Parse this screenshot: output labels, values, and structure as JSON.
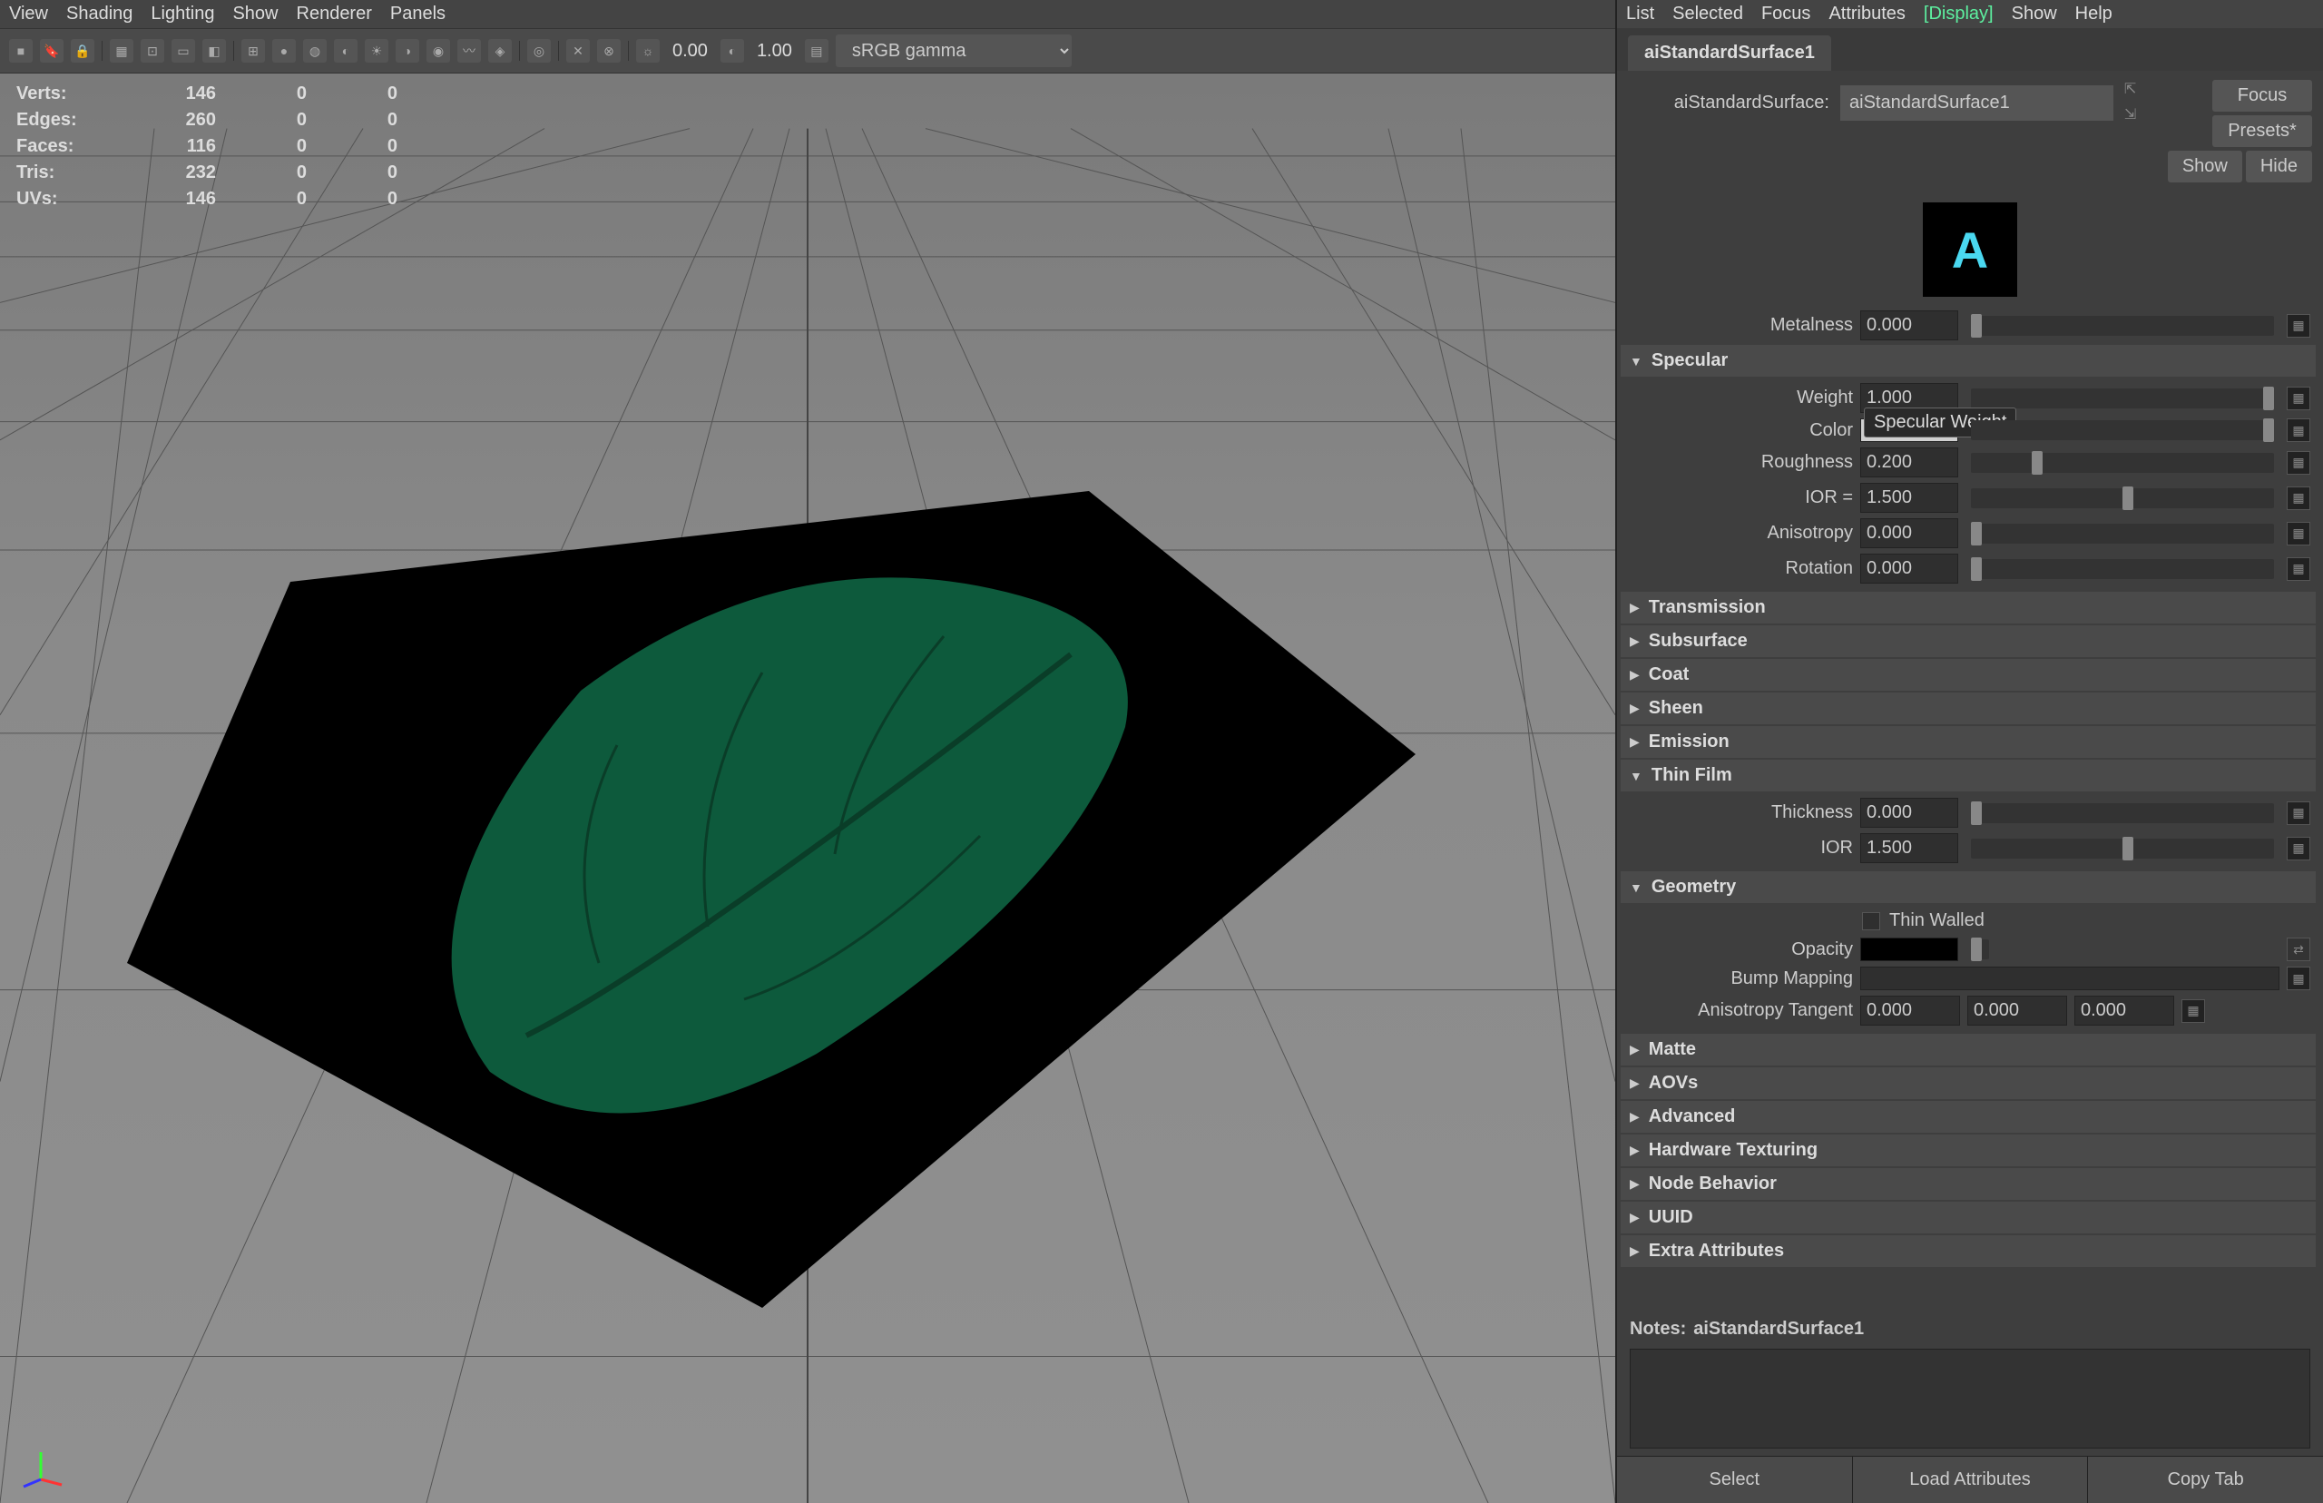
{
  "viewport": {
    "menu": {
      "view": "View",
      "shading": "Shading",
      "lighting": "Lighting",
      "show": "Show",
      "renderer": "Renderer",
      "panels": "Panels"
    },
    "toolbar": {
      "num1": "0.00",
      "num2": "1.00",
      "colorspace": "sRGB gamma"
    },
    "hud": {
      "rows": [
        {
          "label": "Verts:",
          "v1": "146",
          "v2": "0",
          "v3": "0"
        },
        {
          "label": "Edges:",
          "v1": "260",
          "v2": "0",
          "v3": "0"
        },
        {
          "label": "Faces:",
          "v1": "116",
          "v2": "0",
          "v3": "0"
        },
        {
          "label": "Tris:",
          "v1": "232",
          "v2": "0",
          "v3": "0"
        },
        {
          "label": "UVs:",
          "v1": "146",
          "v2": "0",
          "v3": "0"
        }
      ]
    }
  },
  "attr": {
    "menu": {
      "list": "List",
      "selected": "Selected",
      "focus": "Focus",
      "attributes": "Attributes",
      "display": "[Display]",
      "show": "Show",
      "help": "Help"
    },
    "tab": "aiStandardSurface1",
    "node_label": "aiStandardSurface:",
    "node_name": "aiStandardSurface1",
    "buttons": {
      "focus": "Focus",
      "presets": "Presets*",
      "show": "Show",
      "hide": "Hide"
    },
    "sections": {
      "specular": "Specular",
      "transmission": "Transmission",
      "subsurface": "Subsurface",
      "coat": "Coat",
      "sheen": "Sheen",
      "emission": "Emission",
      "thin_film": "Thin Film",
      "geometry": "Geometry",
      "matte": "Matte",
      "aovs": "AOVs",
      "advanced": "Advanced",
      "hardware_texturing": "Hardware Texturing",
      "node_behavior": "Node Behavior",
      "uuid": "UUID",
      "extra": "Extra Attributes"
    },
    "params": {
      "metalness_label": "Metalness",
      "metalness": "0.000",
      "spec_weight_label": "Weight",
      "spec_weight": "1.000",
      "spec_color_label": "Color",
      "roughness_label": "Roughness",
      "roughness": "0.200",
      "ior_label": "IOR =",
      "ior": "1.500",
      "anisotropy_label": "Anisotropy",
      "anisotropy": "0.000",
      "rotation_label": "Rotation",
      "rotation": "0.000",
      "tf_thickness_label": "Thickness",
      "tf_thickness": "0.000",
      "tf_ior_label": "IOR",
      "tf_ior": "1.500",
      "thin_walled_label": "Thin Walled",
      "opacity_label": "Opacity",
      "bump_label": "Bump Mapping",
      "aniso_tangent_label": "Anisotropy Tangent",
      "aniso_tangent_x": "0.000",
      "aniso_tangent_y": "0.000",
      "aniso_tangent_z": "0.000",
      "tooltip": "Specular Weight"
    },
    "notes_label": "Notes:",
    "notes_name": "aiStandardSurface1",
    "footer": {
      "select": "Select",
      "load": "Load Attributes",
      "copy": "Copy Tab"
    }
  }
}
